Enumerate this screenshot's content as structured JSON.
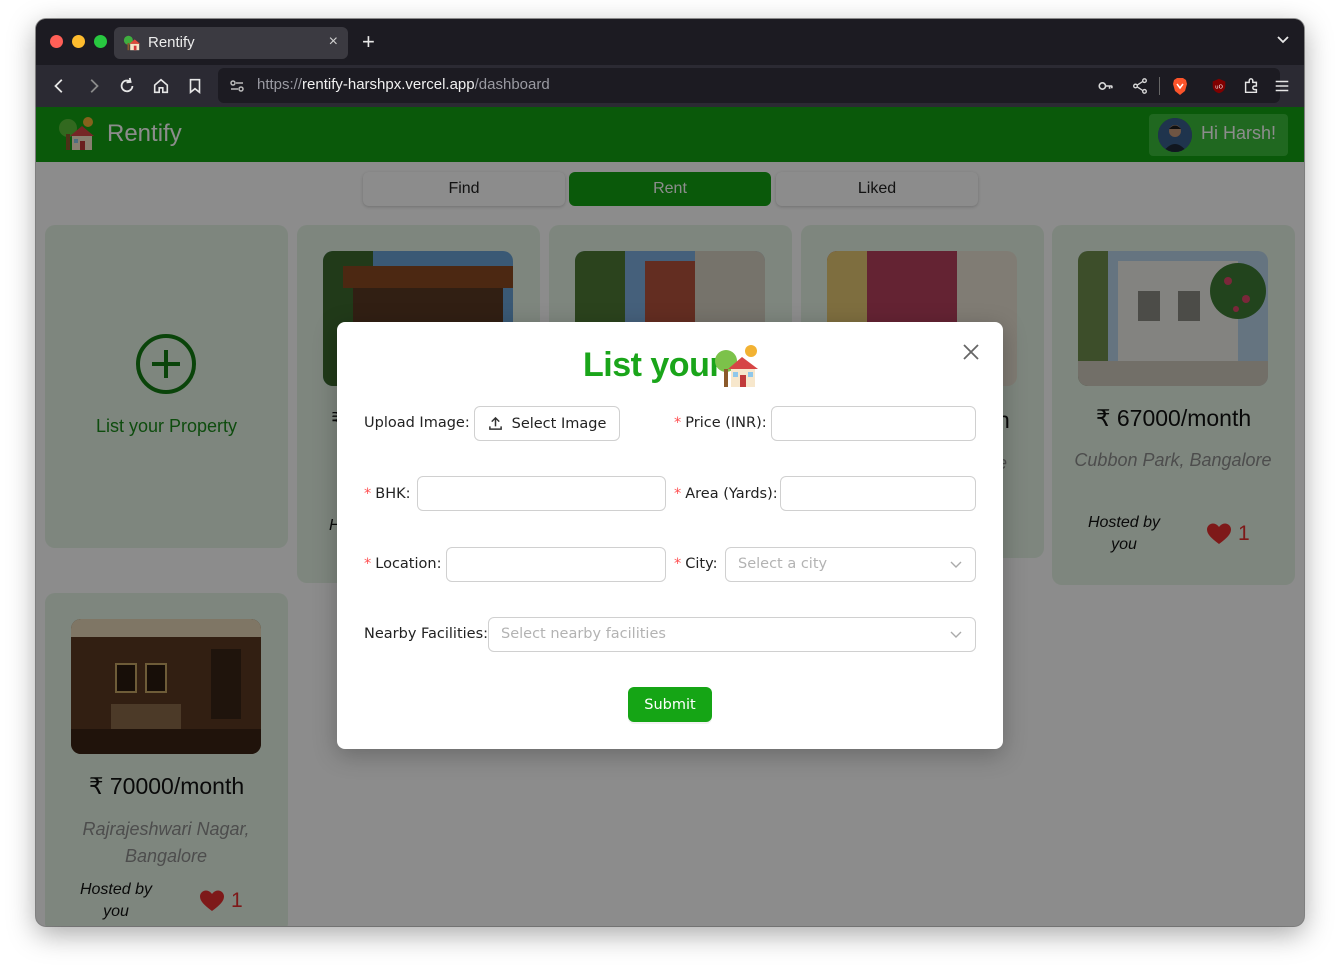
{
  "browser": {
    "tab_title": "Rentify",
    "tab_close": "×",
    "new_tab": "+",
    "url_scheme": "https://",
    "url_host": "rentify-harshpx.vercel.app",
    "url_path": "/dashboard"
  },
  "header": {
    "brand": "Rentify",
    "greeting": "Hi Harsh!"
  },
  "tabs": {
    "find": "Find",
    "rent": "Rent",
    "liked": "Liked"
  },
  "add_card": {
    "label": "List your Property"
  },
  "cards": [
    {
      "price": "₹ 67000/month",
      "location": "Cubbon Park, Bangalore",
      "host": "Hosted by you",
      "likes": "1"
    },
    {
      "price": "₹ 70000/month",
      "location": "Rajrajeshwari Nagar, Bangalore",
      "host": "Hosted by you",
      "likes": "1"
    }
  ],
  "peek": {
    "price_fragment_left": "₹",
    "host_fragment": "H",
    "price_fragment_right": "n",
    "loc_fragment_right": "e"
  },
  "modal": {
    "title": "List your",
    "upload_label": "Upload Image",
    "upload_button": "Select Image",
    "price_label": "Price (INR)",
    "bhk_label": "BHK",
    "area_label": "Area (Yards)",
    "location_label": "Location",
    "city_label": "City",
    "city_placeholder": "Select a city",
    "facilities_label": "Nearby Facilities",
    "facilities_placeholder": "Select nearby facilities",
    "submit": "Submit",
    "required_mark": "*",
    "colon": ":"
  },
  "colors": {
    "brand_green": "#13a313",
    "card_bg": "#e6f5e6",
    "like_red": "#e62e2e",
    "required_red": "#ff4d4f"
  }
}
